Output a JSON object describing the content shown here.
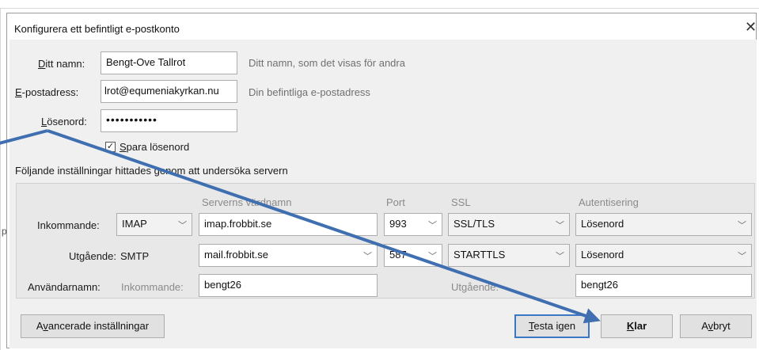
{
  "dialog": {
    "title": "Konfigurera ett befintligt e-postkonto",
    "close_symbol": "✕"
  },
  "account": {
    "name_label_pre": "D",
    "name_label_post": "itt namn:",
    "name_value": "Bengt-Ove Tallrot",
    "name_hint": "Ditt namn, som det visas för andra",
    "email_label_pre": "E",
    "email_label_post": "-postadress:",
    "email_value": "lrot@equmeniakyrkan.nu",
    "email_hint": "Din befintliga e-postadress",
    "password_label_pre": "L",
    "password_label_post": "ösenord:",
    "password_value": "•••••••••••",
    "remember_pre": "S",
    "remember_post": "para lösenord",
    "remember_checked": "✓"
  },
  "found_text": "Följande inställningar hittades genom att undersöka servern",
  "server": {
    "col_hostname": "Serverns värdnamn",
    "col_port": "Port",
    "col_ssl": "SSL",
    "col_auth": "Autentisering",
    "incoming": {
      "label": "Inkommande:",
      "protocol": "IMAP",
      "hostname": "imap.frobbit.se",
      "port": "993",
      "ssl": "SSL/TLS",
      "auth": "Lösenord"
    },
    "outgoing": {
      "label": "Utgående:",
      "protocol": "SMTP",
      "hostname": "mail.frobbit.se",
      "port": "587",
      "ssl": "STARTTLS",
      "auth": "Lösenord"
    },
    "username": {
      "label": "Användarnamn:",
      "incoming_label": "Inkommande:",
      "incoming_value": "bengt26",
      "outgoing_label": "Utgående:",
      "outgoing_value": "bengt26"
    }
  },
  "buttons": {
    "advanced_pre": "A",
    "advanced_mid": "v",
    "advanced_post": "ancerade inställningar",
    "retest_pre": "T",
    "retest_post": "esta igen",
    "done_pre": "K",
    "done_post": "lar",
    "cancel_pre": "A",
    "cancel_mid": "v",
    "cancel_post": "bryt"
  },
  "background_stub": "p",
  "colors": {
    "arrow": "#3f6fb0",
    "focus": "#3b78c4"
  },
  "icons": {
    "chevron": "chevron-down-icon",
    "close": "close-icon",
    "checkbox": "checkbox-icon"
  }
}
